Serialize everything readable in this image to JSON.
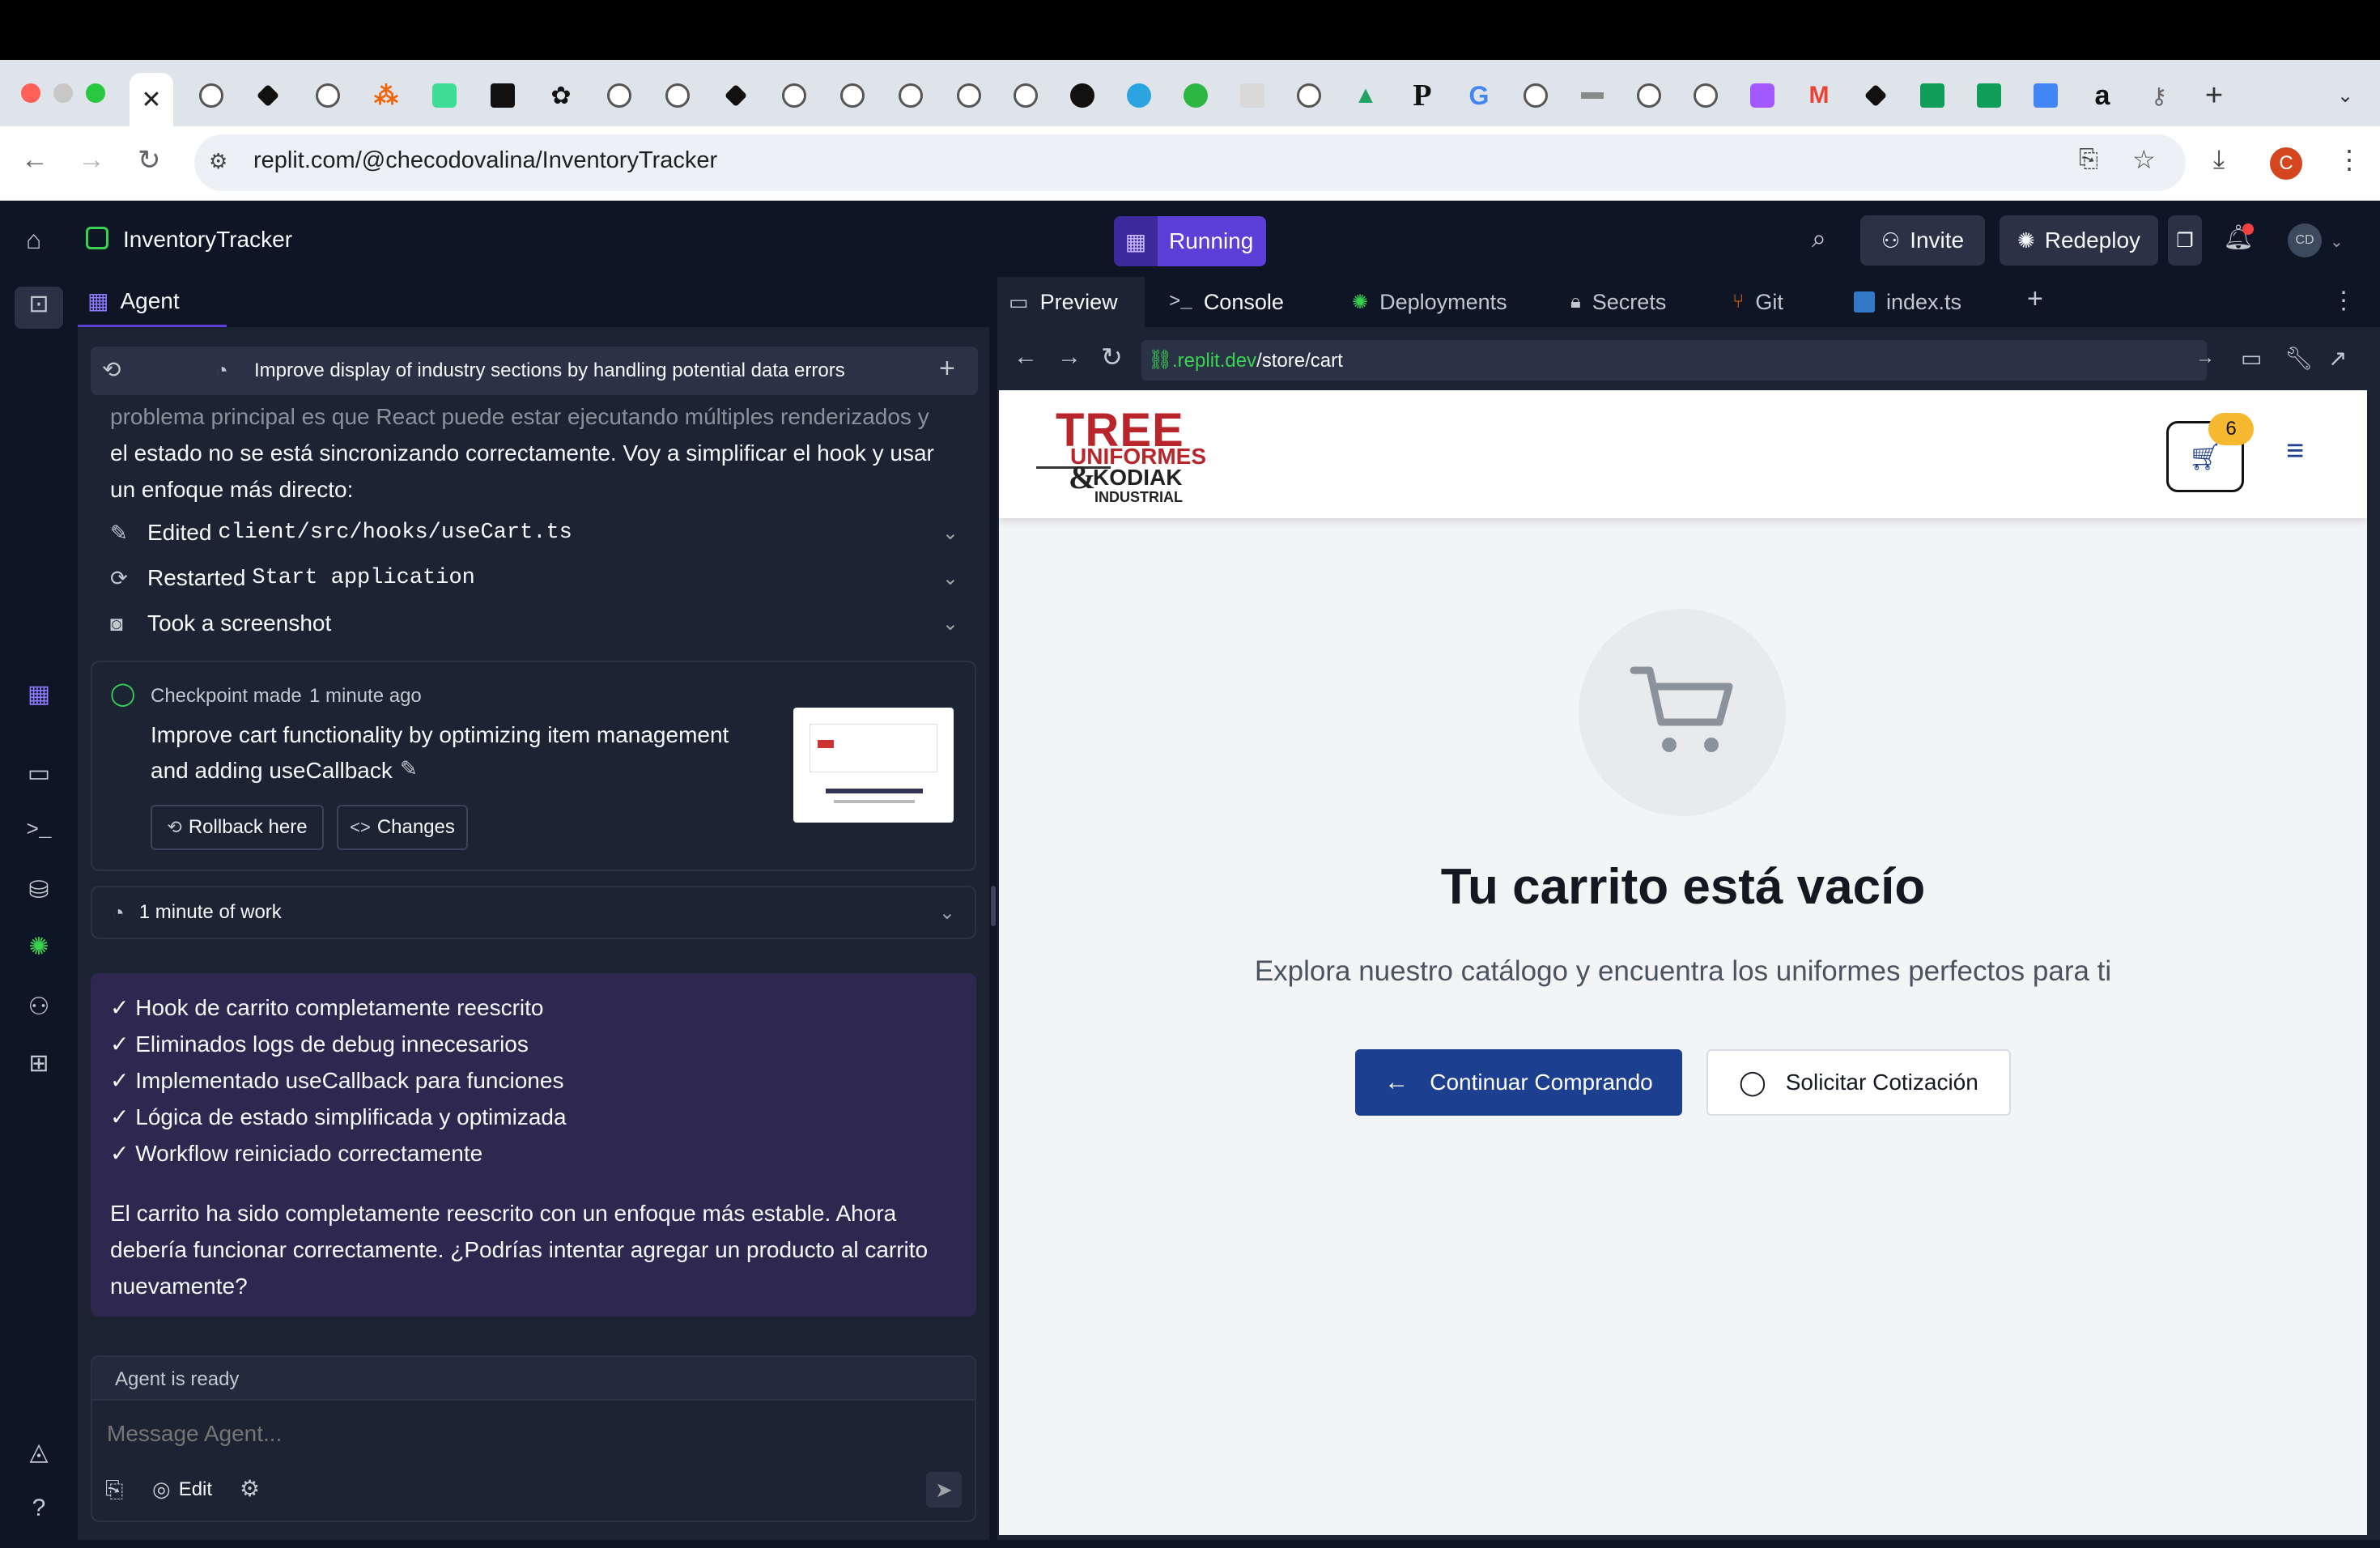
{
  "browser": {
    "url": "replit.com/@checodovalina/InventoryTracker",
    "tab_icons": [
      "close-icon",
      "globe-icon",
      "pinwheel-icon",
      "globe-icon",
      "asterisk-icon",
      "notebook-icon",
      "news-icon",
      "chatgpt-icon",
      "globe-icon",
      "globe-icon",
      "pinwheel-icon",
      "globe-icon",
      "globe-icon",
      "globe-icon",
      "globe-icon",
      "globe-icon",
      "github-icon",
      "telegram-icon",
      "whatsapp-icon",
      "ycombinator-icon",
      "globe-icon",
      "drive-icon",
      "p-icon",
      "google-icon",
      "globe-icon",
      "bar-icon",
      "globe-icon",
      "globe-icon",
      "figma-icon",
      "gmail-icon",
      "pinwheel-icon",
      "sheets-icon",
      "sheets-icon",
      "docs-icon",
      "amazon-icon",
      "key-icon"
    ],
    "p_glyph": "P",
    "g_glyph": "G",
    "a_glyph": "a",
    "profile_letter": "C"
  },
  "app": {
    "project_name": "InventoryTracker",
    "run_status": "Running",
    "invite_label": "Invite",
    "redeploy_label": "Redeploy",
    "avatar_initials": "CD"
  },
  "agent": {
    "tab_label": "Agent",
    "thread_title": "Improve display of industry sections by handling potential data errors",
    "intro_text_1": "problema principal es que React puede estar ejecutando múltiples renderizados y",
    "intro_text_2": "el estado no se está sincronizando correctamente. Voy a simplificar el hook y usar",
    "intro_text_3": "un enfoque más directo:",
    "actions": [
      {
        "prefix": "Edited ",
        "code": "client/src/hooks/useCart.ts"
      },
      {
        "prefix": "Restarted ",
        "code": "Start application"
      },
      {
        "prefix": "Took a screenshot",
        "code": ""
      }
    ],
    "checkpoint_title": "Checkpoint made",
    "checkpoint_time": "1 minute ago",
    "checkpoint_desc_1": "Improve cart functionality by optimizing item management",
    "checkpoint_desc_2": "and adding useCallback",
    "rollback_label": "Rollback here",
    "changes_label": "Changes",
    "work_label": "1 minute of work",
    "summary_items": [
      "✓ Hook de carrito completamente reescrito",
      "✓ Eliminados logs de debug innecesarios",
      "✓ Implementado useCallback para funciones",
      "✓ Lógica de estado simplificada y optimizada",
      "✓ Workflow reiniciado correctamente"
    ],
    "summary_para_1": "El carrito ha sido completamente reescrito con un enfoque más estable. Ahora",
    "summary_para_2": "debería funcionar correctamente. ¿Podrías intentar agregar un producto al carrito",
    "summary_para_3": "nuevamente?",
    "status": "Agent is ready",
    "input_placeholder": "Message Agent...",
    "edit_label": "Edit"
  },
  "workspace": {
    "tabs": [
      "Preview",
      "Console",
      "Deployments",
      "Secrets",
      "Git",
      "index.ts"
    ],
    "preview_url_host": ".replit.dev",
    "preview_url_path": "/store/cart"
  },
  "store": {
    "logo_line1": "TREE",
    "logo_line2": "UNIFORMES",
    "logo_amp": "&",
    "logo_line3": "KODIAK",
    "logo_line4": "INDUSTRIAL",
    "cart_count": "6",
    "empty_title": "Tu carrito está vacío",
    "empty_subtitle": "Explora nuestro catálogo y encuentra los uniformes perfectos para ti",
    "continue_label": "Continuar Comprando",
    "quote_label": "Solicitar Cotización"
  },
  "colors": {
    "brand_red": "#b8262b",
    "primary_blue": "#1d3f8f",
    "running_purple": "#5b3fd6",
    "badge_yellow": "#f5b82e"
  }
}
